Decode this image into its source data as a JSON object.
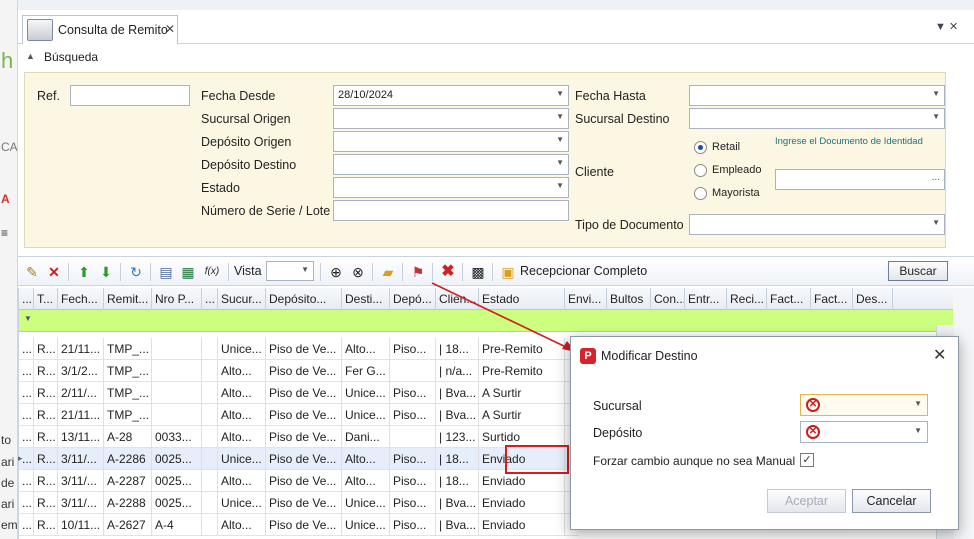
{
  "left_strip_texts": [
    "h",
    "CA",
    "A",
    "≡",
    "to",
    "ari",
    "de",
    "ari",
    "em"
  ],
  "tab": {
    "title": "Consulta de Remito",
    "close": "✕"
  },
  "tab_controls": "▼  ✕",
  "search_section": {
    "title": "Búsqueda",
    "collapse_glyph": "▲"
  },
  "filters": {
    "ref_label": "Ref.",
    "fecha_desde_label": "Fecha Desde",
    "fecha_desde_value": "28/10/2024",
    "fecha_hasta_label": "Fecha Hasta",
    "sucursal_origen_label": "Sucursal Origen",
    "sucursal_destino_label": "Sucursal Destino",
    "deposito_origen_label": "Depósito Origen",
    "deposito_destino_label": "Depósito Destino",
    "estado_label": "Estado",
    "numero_serie_label": "Número de Serie / Lote",
    "cliente_label": "Cliente",
    "cliente_hint": "Ingrese el Documento de Identidad",
    "cliente_options": [
      "Retail",
      "Empleado",
      "Mayorista"
    ],
    "cliente_selected": "Retail",
    "cliente_lookup_button": "...",
    "tipo_documento_label": "Tipo de Documento"
  },
  "toolbar": {
    "vista_label": "Vista",
    "recepcionar_label": "Recepcionar Completo",
    "buscar_label": "Buscar",
    "icons": [
      "edit-icon",
      "delete-icon",
      "move-up-icon",
      "move-down-icon",
      "refresh-icon",
      "document-icon",
      "excel-icon",
      "formula-icon",
      "zoom-in-icon",
      "zoom-reset-icon",
      "folder-icon",
      "change-destination-icon",
      "cancel-icon",
      "barcode-icon",
      "package-icon"
    ],
    "accent_red": "#d02020"
  },
  "grid": {
    "columns": [
      "...",
      "T...",
      "Fech...",
      "Remit...",
      "Nro P...",
      "...",
      "Sucur...",
      "Depósito...",
      "Desti...",
      "Depó...",
      "Clien...",
      "Estado",
      "Envi...",
      "Bultos",
      "Con...",
      "Entr...",
      "Reci...",
      "Fact...",
      "Fact...",
      "Des..."
    ],
    "filter_row_glyph": "▼",
    "rows": [
      [
        "...",
        "R...",
        "21/11...",
        "TMP_...",
        "",
        "",
        "Unice...",
        "Piso de Ve...",
        "Alto...",
        "Piso...",
        "| 18...",
        "Pre-Remito"
      ],
      [
        "...",
        "R...",
        "3/1/2...",
        "TMP_...",
        "",
        "",
        "Alto...",
        "Piso de Ve...",
        "Fer G...",
        "",
        "| n/a...",
        "Pre-Remito"
      ],
      [
        "...",
        "R...",
        "2/11/...",
        "TMP_...",
        "",
        "",
        "Alto...",
        "Piso de Ve...",
        "Unice...",
        "Piso...",
        "| Bva...",
        "A Surtir"
      ],
      [
        "...",
        "R...",
        "21/11...",
        "TMP_...",
        "",
        "",
        "Alto...",
        "Piso de Ve...",
        "Unice...",
        "Piso...",
        "| Bva...",
        "A Surtir"
      ],
      [
        "...",
        "R...",
        "13/11...",
        "A-28",
        "0033...",
        "",
        "Alto...",
        "Piso de Ve...",
        "Dani...",
        "",
        "| 123...",
        "Surtido"
      ],
      [
        "...",
        "R...",
        "3/11/...",
        "A-2286",
        "0025...",
        "",
        "Unice...",
        "Piso de Ve...",
        "Alto...",
        "Piso...",
        "| 18...",
        "Enviado"
      ],
      [
        "...",
        "R...",
        "3/11/...",
        "A-2287",
        "0025...",
        "",
        "Alto...",
        "Piso de Ve...",
        "Alto...",
        "Piso...",
        "| 18...",
        "Enviado"
      ],
      [
        "...",
        "R...",
        "3/11/...",
        "A-2288",
        "0025...",
        "",
        "Unice...",
        "Piso de Ve...",
        "Unice...",
        "Piso...",
        "| Bva...",
        "Enviado"
      ],
      [
        "...",
        "R...",
        "10/11...",
        "A-2627",
        "A-4",
        "",
        "Alto...",
        "Piso de Ve...",
        "Unice...",
        "Piso...",
        "| Bva...",
        "Enviado"
      ]
    ],
    "selected_row_index": 5,
    "row_indicator": "▸"
  },
  "dialog": {
    "title": "Modificar Destino",
    "close": "✕",
    "icon_letter": "P",
    "sucursal_label": "Sucursal",
    "deposito_label": "Depósito",
    "forzar_label": "Forzar cambio aunque no sea Manual",
    "forzar_checked": "✓",
    "error_glyph": "✕",
    "accept_label": "Aceptar",
    "cancel_label": "Cancelar"
  }
}
